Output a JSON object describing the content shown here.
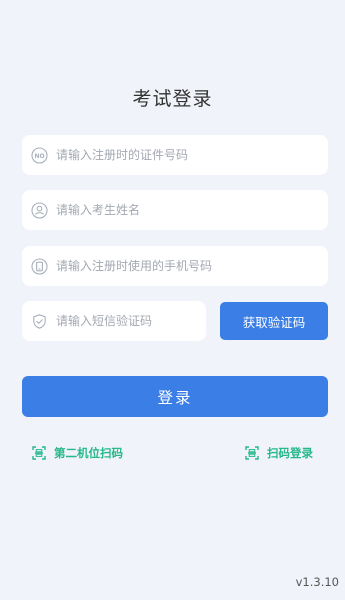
{
  "page": {
    "title": "考试登录",
    "version": "v1.3.10"
  },
  "form": {
    "id_number_placeholder": "请输入注册时的证件号码",
    "name_placeholder": "请输入考生姓名",
    "phone_placeholder": "请输入注册时使用的手机号码",
    "sms_code_placeholder": "请输入短信验证码",
    "get_code_label": "获取验证码",
    "login_label": "登录"
  },
  "links": {
    "second_device_scan": "第二机位扫码",
    "scan_login": "扫码登录"
  },
  "icons": {
    "id_field": "id-card-icon",
    "name_field": "user-icon",
    "phone_field": "phone-icon",
    "sms_field": "shield-check-icon",
    "scan": "scan-icon"
  },
  "colors": {
    "primary": "#3a7ee6",
    "accent_green": "#26b88a",
    "background": "#f0f3f9"
  }
}
